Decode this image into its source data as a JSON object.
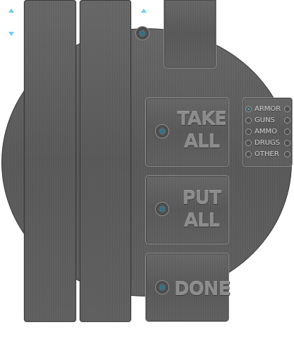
{
  "colors": {
    "metal": "#5a5a5a",
    "accent": "#6cd0f0",
    "label_text": "#8c8c8c",
    "filter_text": "#cfcfcf"
  },
  "icons": {
    "scroll_up": "triangle-up",
    "scroll_down": "triangle-down",
    "knob": "round-screw-knob"
  },
  "buttons": {
    "take_all": {
      "line1": "TAKE",
      "line2": "ALL"
    },
    "put_all": {
      "line1": "PUT",
      "line2": "ALL"
    },
    "done": {
      "label": "DONE"
    }
  },
  "filters": {
    "items": [
      {
        "label": "ARMOR"
      },
      {
        "label": "GUNS"
      },
      {
        "label": "AMMO"
      },
      {
        "label": "DRUGS"
      },
      {
        "label": "OTHER"
      }
    ]
  }
}
